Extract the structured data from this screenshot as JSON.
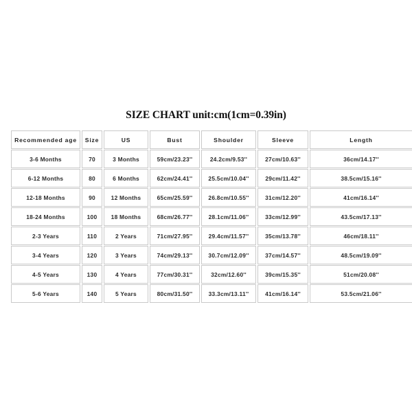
{
  "title": "SIZE CHART unit:cm(1cm=0.39in)",
  "table": {
    "headers": [
      "Recommended age",
      "Size",
      "US",
      "Bust",
      "Shoulder",
      "Sleeve",
      "Length"
    ],
    "rows": [
      {
        "age": "3-6 Months",
        "size": "70",
        "us": "3 Months",
        "bust": "59cm/23.23''",
        "shoulder": "24.2cm/9.53''",
        "sleeve": "27cm/10.63''",
        "length": "36cm/14.17''"
      },
      {
        "age": "6-12 Months",
        "size": "80",
        "us": "6 Months",
        "bust": "62cm/24.41''",
        "shoulder": "25.5cm/10.04''",
        "sleeve": "29cm/11.42''",
        "length": "38.5cm/15.16''"
      },
      {
        "age": "12-18 Months",
        "size": "90",
        "us": "12 Months",
        "bust": "65cm/25.59''",
        "shoulder": "26.8cm/10.55''",
        "sleeve": "31cm/12.20''",
        "length": "41cm/16.14''"
      },
      {
        "age": "18-24 Months",
        "size": "100",
        "us": "18 Months",
        "bust": "68cm/26.77''",
        "shoulder": "28.1cm/11.06''",
        "sleeve": "33cm/12.99''",
        "length": "43.5cm/17.13''"
      },
      {
        "age": "2-3 Years",
        "size": "110",
        "us": "2 Years",
        "bust": "71cm/27.95''",
        "shoulder": "29.4cm/11.57''",
        "sleeve": "35cm/13.78''",
        "length": "46cm/18.11''"
      },
      {
        "age": "3-4 Years",
        "size": "120",
        "us": "3 Years",
        "bust": "74cm/29.13''",
        "shoulder": "30.7cm/12.09''",
        "sleeve": "37cm/14.57''",
        "length": "48.5cm/19.09''"
      },
      {
        "age": "4-5 Years",
        "size": "130",
        "us": "4 Years",
        "bust": "77cm/30.31''",
        "shoulder": "32cm/12.60''",
        "sleeve": "39cm/15.35''",
        "length": "51cm/20.08''"
      },
      {
        "age": "5-6 Years",
        "size": "140",
        "us": "5 Years",
        "bust": "80cm/31.50''",
        "shoulder": "33.3cm/13.11''",
        "sleeve": "41cm/16.14''",
        "length": "53.5cm/21.06''"
      }
    ]
  },
  "chart_data": {
    "type": "table",
    "title": "SIZE CHART unit:cm(1cm=0.39in)",
    "columns": [
      "Recommended age",
      "Size",
      "US",
      "Bust",
      "Shoulder",
      "Sleeve",
      "Length"
    ],
    "rows": [
      [
        "3-6 Months",
        "70",
        "3 Months",
        "59cm/23.23''",
        "24.2cm/9.53''",
        "27cm/10.63''",
        "36cm/14.17''"
      ],
      [
        "6-12 Months",
        "80",
        "6 Months",
        "62cm/24.41''",
        "25.5cm/10.04''",
        "29cm/11.42''",
        "38.5cm/15.16''"
      ],
      [
        "12-18 Months",
        "90",
        "12 Months",
        "65cm/25.59''",
        "26.8cm/10.55''",
        "31cm/12.20''",
        "41cm/16.14''"
      ],
      [
        "18-24 Months",
        "100",
        "18 Months",
        "68cm/26.77''",
        "28.1cm/11.06''",
        "33cm/12.99''",
        "43.5cm/17.13''"
      ],
      [
        "2-3 Years",
        "110",
        "2 Years",
        "71cm/27.95''",
        "29.4cm/11.57''",
        "35cm/13.78''",
        "46cm/18.11''"
      ],
      [
        "3-4 Years",
        "120",
        "3 Years",
        "74cm/29.13''",
        "30.7cm/12.09''",
        "37cm/14.57''",
        "48.5cm/19.09''"
      ],
      [
        "4-5 Years",
        "130",
        "4 Years",
        "77cm/30.31''",
        "32cm/12.60''",
        "39cm/15.35''",
        "51cm/20.08''"
      ],
      [
        "5-6 Years",
        "140",
        "5 Years",
        "80cm/31.50''",
        "33.3cm/13.11''",
        "41cm/16.14''",
        "53.5cm/21.06''"
      ]
    ],
    "units": {
      "bust_cm": [
        59,
        62,
        65,
        68,
        71,
        74,
        77,
        80
      ],
      "bust_in": [
        23.23,
        24.41,
        25.59,
        26.77,
        27.95,
        29.13,
        30.31,
        31.5
      ],
      "shoulder_cm": [
        24.2,
        25.5,
        26.8,
        28.1,
        29.4,
        30.7,
        32,
        33.3
      ],
      "shoulder_in": [
        9.53,
        10.04,
        10.55,
        11.06,
        11.57,
        12.09,
        12.6,
        13.11
      ],
      "sleeve_cm": [
        27,
        29,
        31,
        33,
        35,
        37,
        39,
        41
      ],
      "sleeve_in": [
        10.63,
        11.42,
        12.2,
        12.99,
        13.78,
        14.57,
        15.35,
        16.14
      ],
      "length_cm": [
        36,
        38.5,
        41,
        43.5,
        46,
        48.5,
        51,
        53.5
      ],
      "length_in": [
        14.17,
        15.16,
        16.14,
        17.13,
        18.11,
        19.09,
        20.08,
        21.06
      ],
      "size_codes": [
        70,
        80,
        90,
        100,
        110,
        120,
        130,
        140
      ]
    }
  },
  "colors": {
    "background": "#ffffff",
    "text": "#2a2a2a",
    "title_text": "#111111",
    "cell_border": "#c9c9c9"
  }
}
